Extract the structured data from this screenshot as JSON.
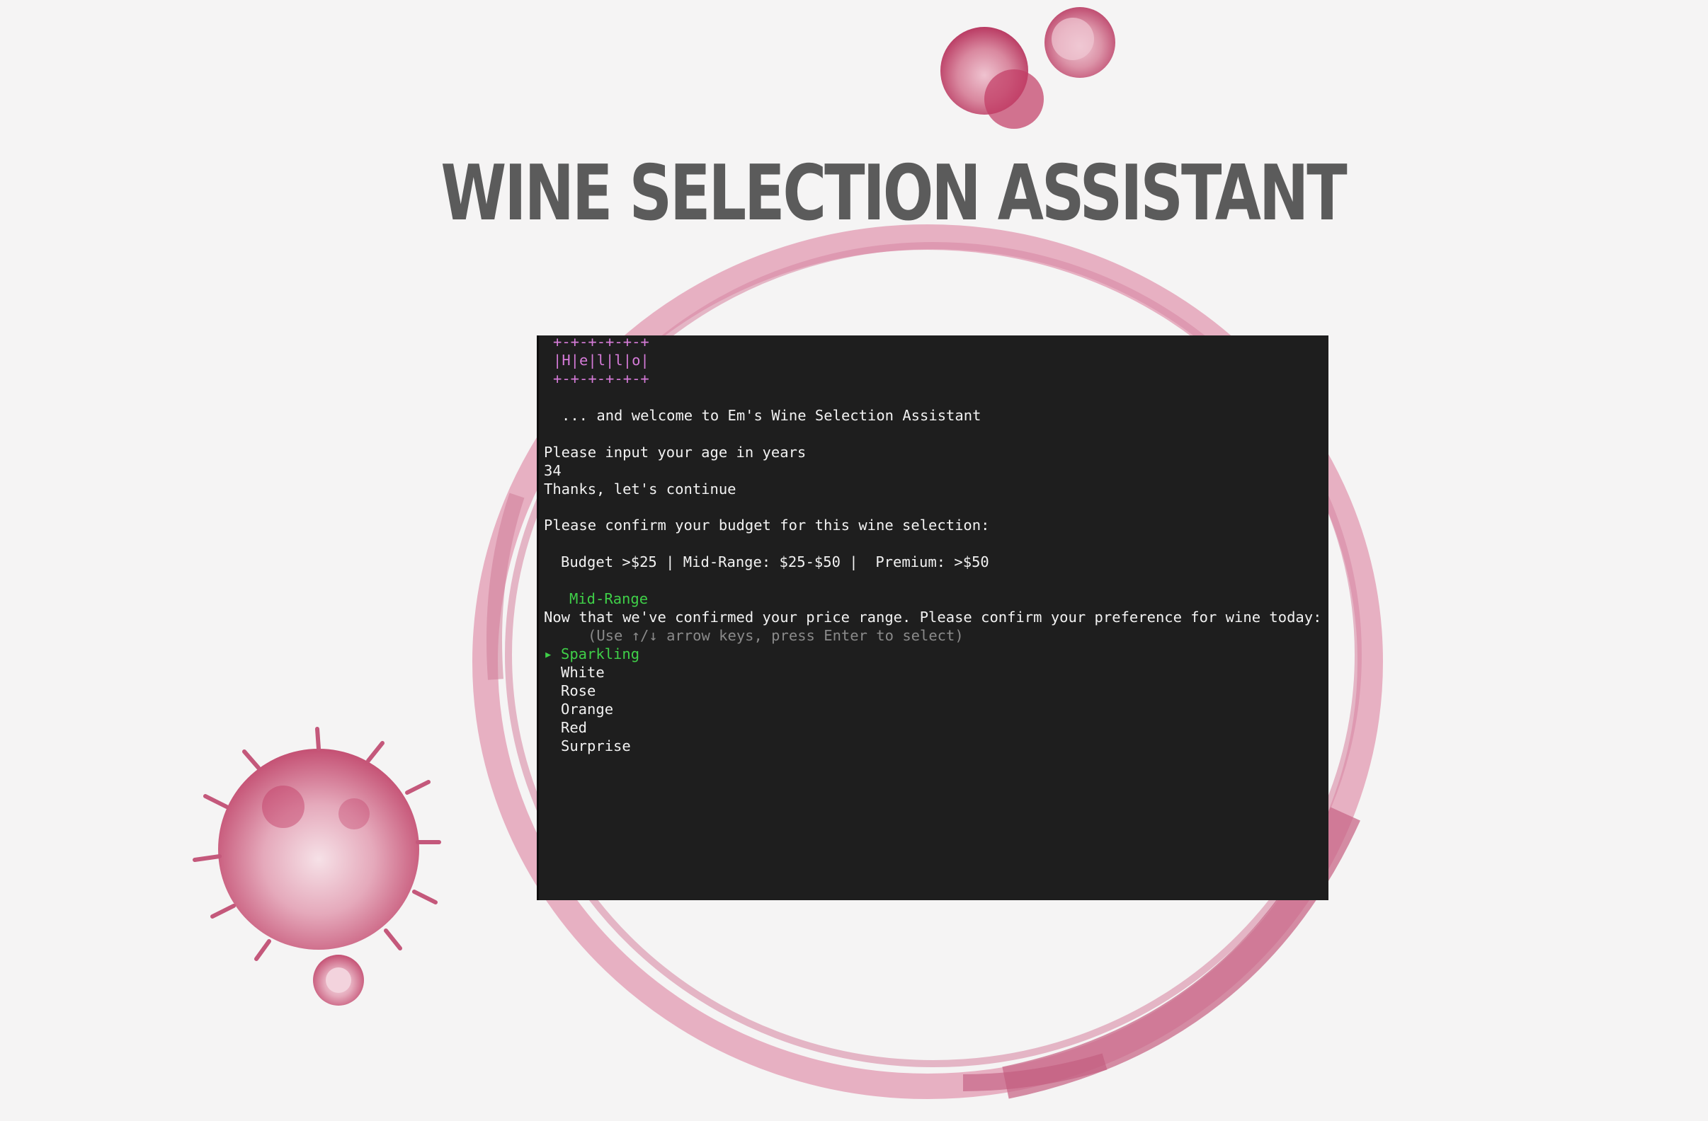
{
  "title": "WINE SELECTION ASSISTANT",
  "colors": {
    "background": "#f5f4f4",
    "title": "#5b5b5b",
    "terminal_bg": "#1e1e1e",
    "terminal_text": "#f2f2f2",
    "banner": "#d57bd8",
    "accent_green": "#3fcf48",
    "hint": "#8a8a8a",
    "wine_stain": "#c0476e"
  },
  "terminal": {
    "banner": {
      "top": "+-+-+-+-+-+",
      "middle": "|H|e|l|l|o|",
      "bottom": "+-+-+-+-+-+"
    },
    "welcome": "... and welcome to Em's Wine Selection Assistant",
    "age_prompt": "Please input your age in years",
    "age_value": "34",
    "age_ack": "Thanks, let's continue",
    "budget_prompt": "Please confirm your budget for this wine selection:",
    "budget_options": "Budget >$25 | Mid-Range: $25-$50 |  Premium: >$50",
    "budget_selected": "Mid-Range",
    "preference_prompt": "Now that we've confirmed your price range. Please confirm your preference for wine today:",
    "hint": "(Use ↑/↓ arrow keys, press Enter to select)",
    "pointer": "▸",
    "options": [
      "Sparkling",
      "White",
      "Rose",
      "Orange",
      "Red",
      "Surprise"
    ],
    "selected_index": 0
  },
  "decorations": [
    "wine-ring-stain",
    "wine-drop-stain-top",
    "wine-splatter-stain-left"
  ]
}
